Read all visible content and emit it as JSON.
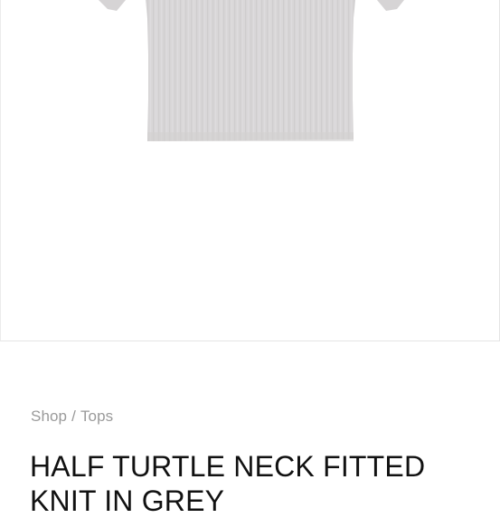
{
  "breadcrumb": {
    "shop_label": "Shop",
    "separator": "/",
    "category_label": "Tops"
  },
  "product": {
    "title": "HALF TURTLE NECK FITTED KNIT IN GREY",
    "image_alt": "HALF TURTLE NECK FITTED KNIT IN GREY",
    "garment_color": "#d9d7d8"
  },
  "colors": {
    "background": "#ffffff",
    "breadcrumb_text": "#9a9a9a",
    "title_text": "#111111",
    "frame_border": "#e4e4e4"
  }
}
